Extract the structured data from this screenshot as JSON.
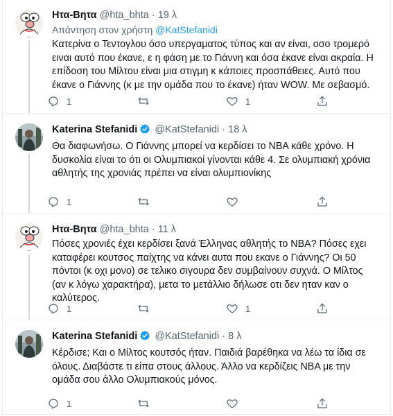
{
  "tweets": [
    {
      "id": "tweet-0",
      "avatar": "cartoon-avatar",
      "name": "Ητα-Βητα",
      "handle": "@hta_bhta",
      "separator": "·",
      "time": "19 λ",
      "verified": false,
      "reply_prefix": "Απάντηση στον χρήστη",
      "reply_mention": "@KatStefanidi",
      "lines": [
        "Κατερίνα ο Τεντογλου όσο υπεργαματος τύπος και αν είναι, οσο τρομερό",
        "ειναι αυτό που έκανε, ε η φάση με το Γιάννη και όσα έκανε είναι ακραία. Η",
        "επίδοση του Μίλτου είναι μια στιγμη κ κάποιες προσπάθειες. Αυτό που",
        "έκανε ο Γιάννης (κ με την ομάδα που το έκανε) ήταν WOW. Με σεβασμό."
      ],
      "counts": {
        "reply": "1",
        "retweet": "",
        "like": "1"
      }
    },
    {
      "id": "tweet-1",
      "avatar": "photo-avatar",
      "name": "Katerina Stefanidi",
      "handle": "@KatStefanidi",
      "separator": "·",
      "time": "18 λ",
      "verified": true,
      "lines": [
        "Θα διαφωνήσω. Ο Γιάννης μπορεί να κερδίσει το ΝΒΑ κάθε χρόνο. Η",
        "δυσκολία είναι το ότι οι Ολυμπιακοί γίνονται κάθε 4. Σε ολυμπιακή χρόνια",
        "αθλητής της χρονιάς πρέπει να είναι ολυμπιονίκης"
      ],
      "counts": {
        "reply": "1",
        "retweet": "",
        "like": ""
      }
    },
    {
      "id": "tweet-2",
      "avatar": "cartoon-avatar",
      "name": "Ητα-Βητα",
      "handle": "@hta_bhta",
      "separator": "·",
      "time": "11 λ",
      "verified": false,
      "lines": [
        "Πόσες χρονιές έχει κερδίσει ξανά Έλληνας αθλητής το NBA? Πόσες εχει",
        "καταφέρει κουτσος παίχτης να κάνει αυτα που εκανε ο Γιάννης? Οι 50",
        "πόντοι (κ οχι μονο) σε τελικο σιγουρα δεν συμβαίνουν συχνά. Ο Μίλτος",
        "(αν κ λόγω χαρακτήρα), μετα το μετάλλιο δήλωσε οτι δεν ηταν καν ο",
        "καλύτερος."
      ],
      "counts": {
        "reply": "1",
        "retweet": "",
        "like": "1"
      }
    },
    {
      "id": "tweet-3",
      "avatar": "photo-avatar",
      "name": "Katerina Stefanidi",
      "handle": "@KatStefanidi",
      "separator": "·",
      "time": "8 λ",
      "verified": true,
      "lines": [
        "Κέρδισε; Και ο Μίλτος κουτσός ήταν. Παιδιά βαρέθηκα να λέω τα ίδια σε",
        "όλους. Διαβάστε τι είπα στους άλλους. Άλλο να κερδίζεις ΝΒΑ με την",
        "ομάδα σου άλλο Ολυμπιακούς μόνος."
      ],
      "counts": {
        "reply": "1",
        "retweet": "",
        "like": ""
      }
    }
  ],
  "icons": {
    "reply": "reply-icon",
    "retweet": "retweet-icon",
    "like": "heart-icon",
    "share": "share-icon",
    "verified": "verified-badge-icon"
  },
  "colors": {
    "text": "#0f1419",
    "secondary": "#536471",
    "accent": "#1d9bf0",
    "thread_line": "#cfd9de",
    "divider": "#eff3f4"
  }
}
